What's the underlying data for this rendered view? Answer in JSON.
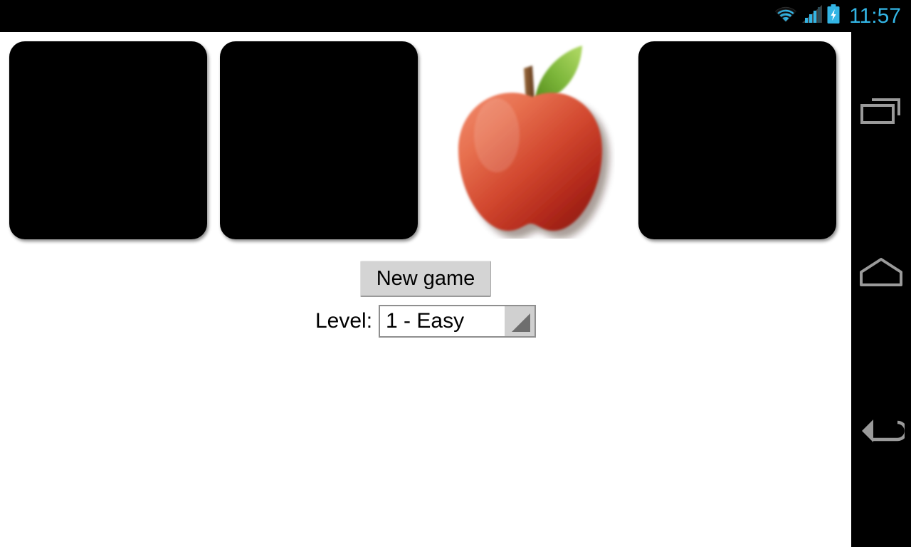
{
  "status_bar": {
    "clock": "11:57",
    "icons": [
      {
        "name": "wifi-icon",
        "label": "wifi"
      },
      {
        "name": "cellular-signal-icon",
        "label": "signal"
      },
      {
        "name": "battery-charging-icon",
        "label": "battery charging"
      }
    ],
    "accent_color": "#33b5e5",
    "background_color": "#000000"
  },
  "app": {
    "background_color": "#ffffff",
    "cards": [
      {
        "index": 1,
        "state": "face-down",
        "face": "card-back",
        "color": "#000000"
      },
      {
        "index": 2,
        "state": "face-down",
        "face": "card-back",
        "color": "#000000"
      },
      {
        "index": 3,
        "state": "face-up",
        "face": "apple",
        "color": "#c23b22"
      },
      {
        "index": 4,
        "state": "face-down",
        "face": "card-back",
        "color": "#000000"
      }
    ],
    "new_game_button": "New game",
    "level_label": "Level:",
    "level_value": "1 - Easy",
    "level_options": [
      "1 - Easy"
    ],
    "button_color": "#d4d4d4"
  },
  "nav_bar": {
    "background_color": "#000000",
    "icon_color": "#9a9a9a",
    "buttons": [
      {
        "name": "recents-button",
        "label": "Recent apps"
      },
      {
        "name": "home-button",
        "label": "Home"
      },
      {
        "name": "back-button",
        "label": "Back"
      }
    ]
  }
}
